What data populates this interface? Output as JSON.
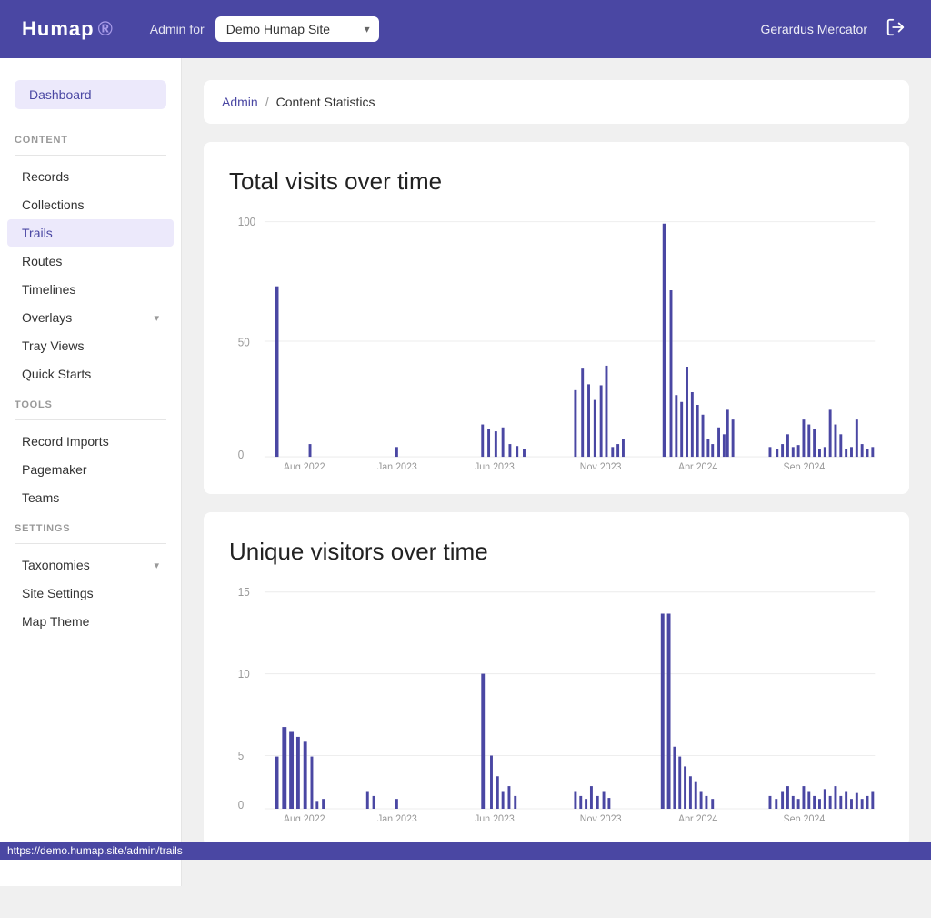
{
  "header": {
    "logo": "Humap",
    "admin_for_label": "Admin for",
    "site_name": "Demo Humap Site",
    "user_name": "Gerardus Mercator",
    "logout_icon": "→"
  },
  "sidebar": {
    "dashboard_label": "Dashboard",
    "content_section": "CONTENT",
    "tools_section": "TOOLS",
    "settings_section": "SETTINGS",
    "nav_items_content": [
      {
        "label": "Records",
        "key": "records",
        "active": false
      },
      {
        "label": "Collections",
        "key": "collections",
        "active": false
      },
      {
        "label": "Trails",
        "key": "trails",
        "active": true
      },
      {
        "label": "Routes",
        "key": "routes",
        "active": false
      },
      {
        "label": "Timelines",
        "key": "timelines",
        "active": false
      },
      {
        "label": "Overlays",
        "key": "overlays",
        "active": false,
        "has_chevron": true
      },
      {
        "label": "Tray Views",
        "key": "tray-views",
        "active": false
      },
      {
        "label": "Quick Starts",
        "key": "quick-starts",
        "active": false
      }
    ],
    "nav_items_tools": [
      {
        "label": "Record Imports",
        "key": "record-imports",
        "active": false
      },
      {
        "label": "Pagemaker",
        "key": "pagemaker",
        "active": false
      },
      {
        "label": "Teams",
        "key": "teams",
        "active": false
      }
    ],
    "nav_items_settings": [
      {
        "label": "Taxonomies",
        "key": "taxonomies",
        "active": false,
        "has_chevron": true
      },
      {
        "label": "Site Settings",
        "key": "site-settings",
        "active": false
      },
      {
        "label": "Map Theme",
        "key": "map-theme",
        "active": false
      }
    ]
  },
  "breadcrumb": {
    "admin_link": "Admin",
    "separator": "/",
    "current": "Content Statistics"
  },
  "charts": {
    "total_visits_title": "Total visits over time",
    "unique_visitors_title": "Unique visitors over time"
  },
  "status_bar": {
    "url": "https://demo.humap.site/admin/trails"
  },
  "colors": {
    "primary": "#4a47a3",
    "bar": "#4a47a3",
    "bar_light": "#6b68c7"
  }
}
